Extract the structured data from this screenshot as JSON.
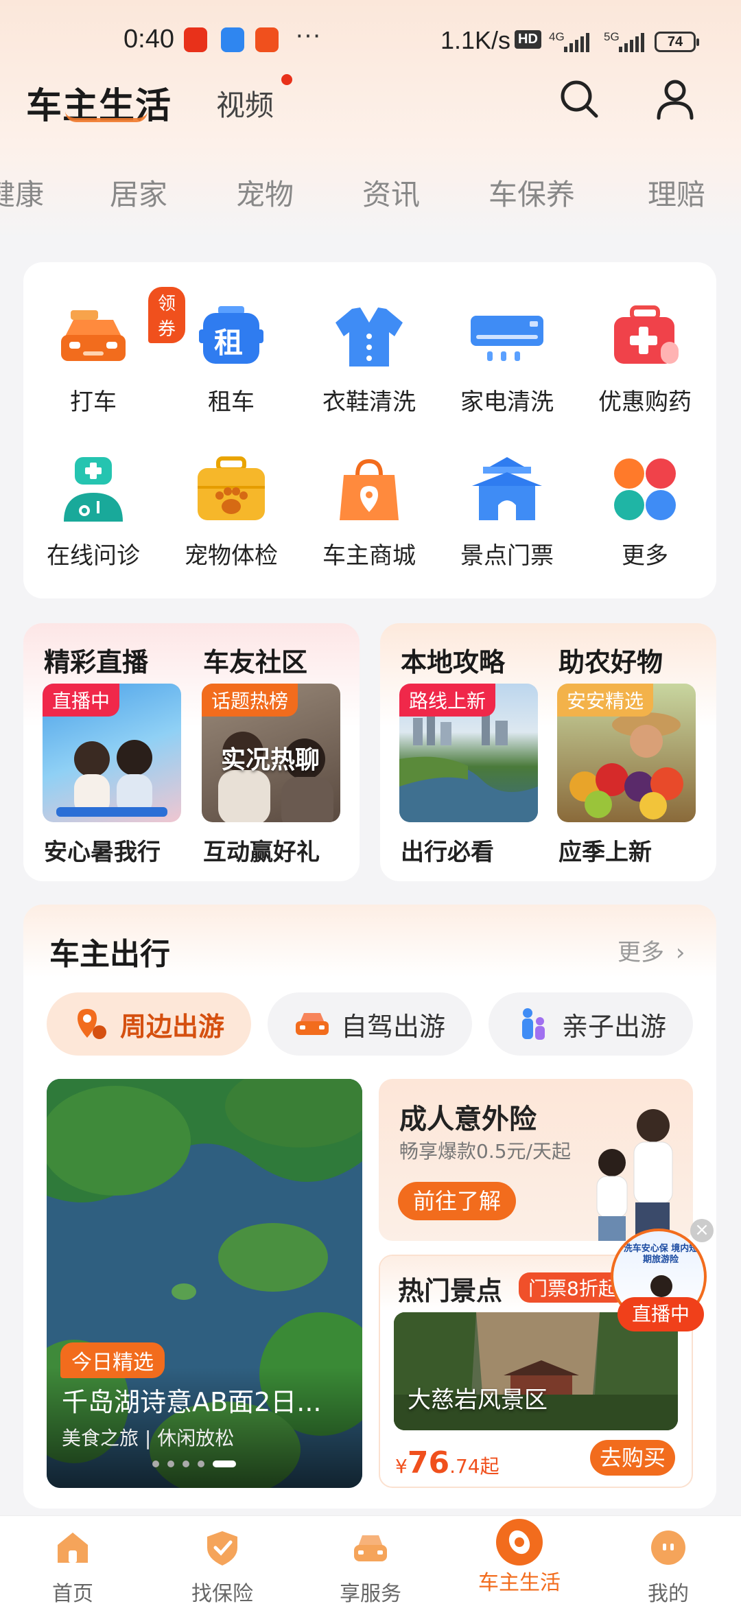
{
  "status_bar": {
    "time": "0:40",
    "dots": "···",
    "net_speed": "1.1K/s",
    "hd": "HD",
    "sig1": "4G",
    "sig2": "5G",
    "battery": "74"
  },
  "header": {
    "brand": "车主生活",
    "video_tab": "视频"
  },
  "category_tabs": [
    "健康",
    "居家",
    "宠物",
    "资讯",
    "车保养",
    "理赔"
  ],
  "services": [
    {
      "label": "打车",
      "icon": "taxi-icon",
      "badge": "领券"
    },
    {
      "label": "租车",
      "icon": "rental-car-icon",
      "glyph": "租"
    },
    {
      "label": "衣鞋清洗",
      "icon": "shirt-icon"
    },
    {
      "label": "家电清洗",
      "icon": "air-conditioner-icon"
    },
    {
      "label": "优惠购药",
      "icon": "medicine-kit-icon"
    },
    {
      "label": "在线问诊",
      "icon": "doctor-icon"
    },
    {
      "label": "宠物体检",
      "icon": "pet-paw-icon"
    },
    {
      "label": "车主商城",
      "icon": "shopping-bag-icon"
    },
    {
      "label": "景点门票",
      "icon": "temple-icon"
    },
    {
      "label": "更多",
      "icon": "more-dots-icon"
    }
  ],
  "promo_left": {
    "col1": {
      "title": "精彩直播",
      "tag": "直播中",
      "caption": "安心暑我行"
    },
    "col2": {
      "title": "车友社区",
      "tag": "话题热榜",
      "overlay": "实况热聊",
      "caption": "互动赢好礼"
    }
  },
  "promo_right": {
    "col1": {
      "title": "本地攻略",
      "tag": "路线上新",
      "caption": "出行必看"
    },
    "col2": {
      "title": "助农好物",
      "tag": "安安精选",
      "caption": "应季上新"
    }
  },
  "travel": {
    "title": "车主出行",
    "more": "更多",
    "chips": [
      {
        "label": "周边出游",
        "icon": "location-pin-icon",
        "active": true
      },
      {
        "label": "自驾出游",
        "icon": "car-icon",
        "active": false
      },
      {
        "label": "亲子出游",
        "icon": "family-icon",
        "active": false
      }
    ],
    "feature": {
      "tag": "今日精选",
      "title": "千岛湖诗意AB面2日...",
      "subtitle": "美食之旅 | 休闲放松"
    },
    "insurance": {
      "title": "成人意外险",
      "subtitle": "畅享爆款0.5元/天起",
      "button": "前往了解"
    },
    "scenic": {
      "title": "热门景点",
      "badge": "门票8折起",
      "place": "大慈岩风景区",
      "currency": "¥",
      "price_int": "76",
      "price_dec": ".74起",
      "button": "去购买"
    },
    "live_float": {
      "banner": "洗车安心保 境内短期旅游险",
      "label": "直播中"
    }
  },
  "bottom_nav": [
    {
      "label": "首页",
      "icon": "home-icon",
      "active": false
    },
    {
      "label": "找保险",
      "icon": "shield-icon",
      "active": false
    },
    {
      "label": "享服务",
      "icon": "car-service-icon",
      "active": false
    },
    {
      "label": "车主生活",
      "icon": "life-icon",
      "active": true
    },
    {
      "label": "我的",
      "icon": "profile-icon",
      "active": false
    }
  ]
}
